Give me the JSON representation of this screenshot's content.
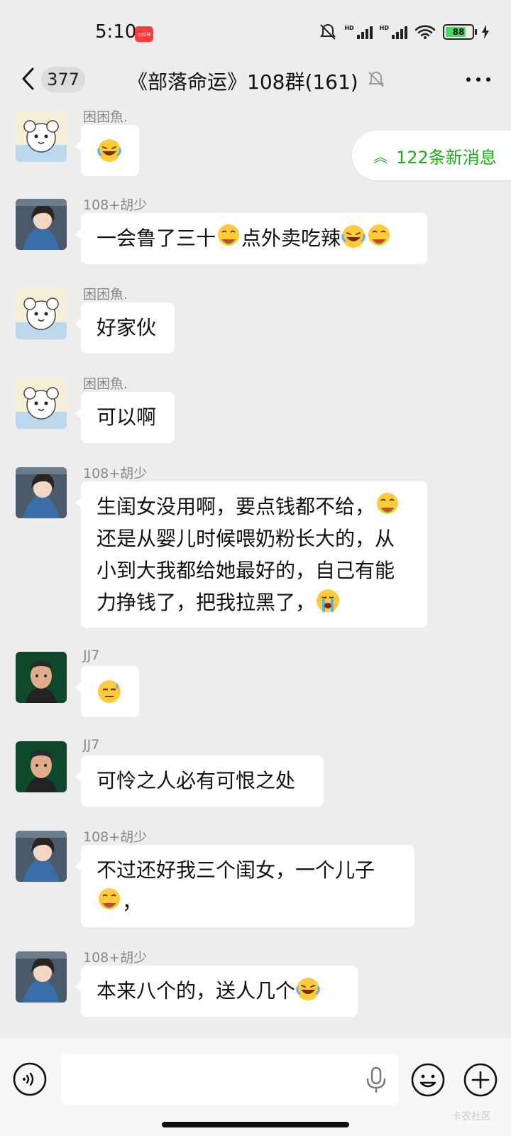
{
  "status_bar": {
    "time": "5:10",
    "app_badge": "小红书",
    "hd1": "HD",
    "hd2": "HD",
    "battery": "88",
    "battery_level": 0.88
  },
  "header": {
    "back_count": "377",
    "title": "《部落命运》108群(161)"
  },
  "new_messages": {
    "label": "122条新消息"
  },
  "messages": [
    {
      "sender": "困困魚.",
      "avatar": "cat-cartoon-avatar",
      "text": ""
    },
    {
      "sender": "108+胡少",
      "avatar": "anime-girl-avatar",
      "text": "一会鲁了三十"
    },
    {
      "sender": "困困魚.",
      "avatar": "cat-cartoon-avatar",
      "text": "好家伙"
    },
    {
      "sender": "困困魚.",
      "avatar": "cat-cartoon-avatar",
      "text": "可以啊"
    },
    {
      "sender": "108+胡少",
      "avatar": "anime-girl-avatar",
      "text_lines": [
        "生闺女没用啊，要点钱都不给，",
        "还是从婴儿时候喂奶粉长大的，从",
        "小到大我都给她最好的，自己有能",
        "力挣钱了，把我拉黑了，"
      ]
    },
    {
      "sender": "JJ7",
      "avatar": "cartoon-man-avatar",
      "text": ""
    },
    {
      "sender": "JJ7",
      "avatar": "cartoon-man-avatar",
      "text": "可怜之人必有可恨之处"
    },
    {
      "sender": "108+胡少",
      "avatar": "anime-girl-avatar",
      "text_lines": [
        "不过还好我三个闺女，一个儿子",
        "，"
      ]
    },
    {
      "sender": "108+胡少",
      "avatar": "anime-girl-avatar",
      "text": "本来八个的，送人几个"
    }
  ],
  "msg2_mid": "点外卖吃辣",
  "watermark": "卡农社区",
  "colors": {
    "background": "#ededed",
    "bubble": "#ffffff",
    "accent_green": "#1aad19"
  }
}
